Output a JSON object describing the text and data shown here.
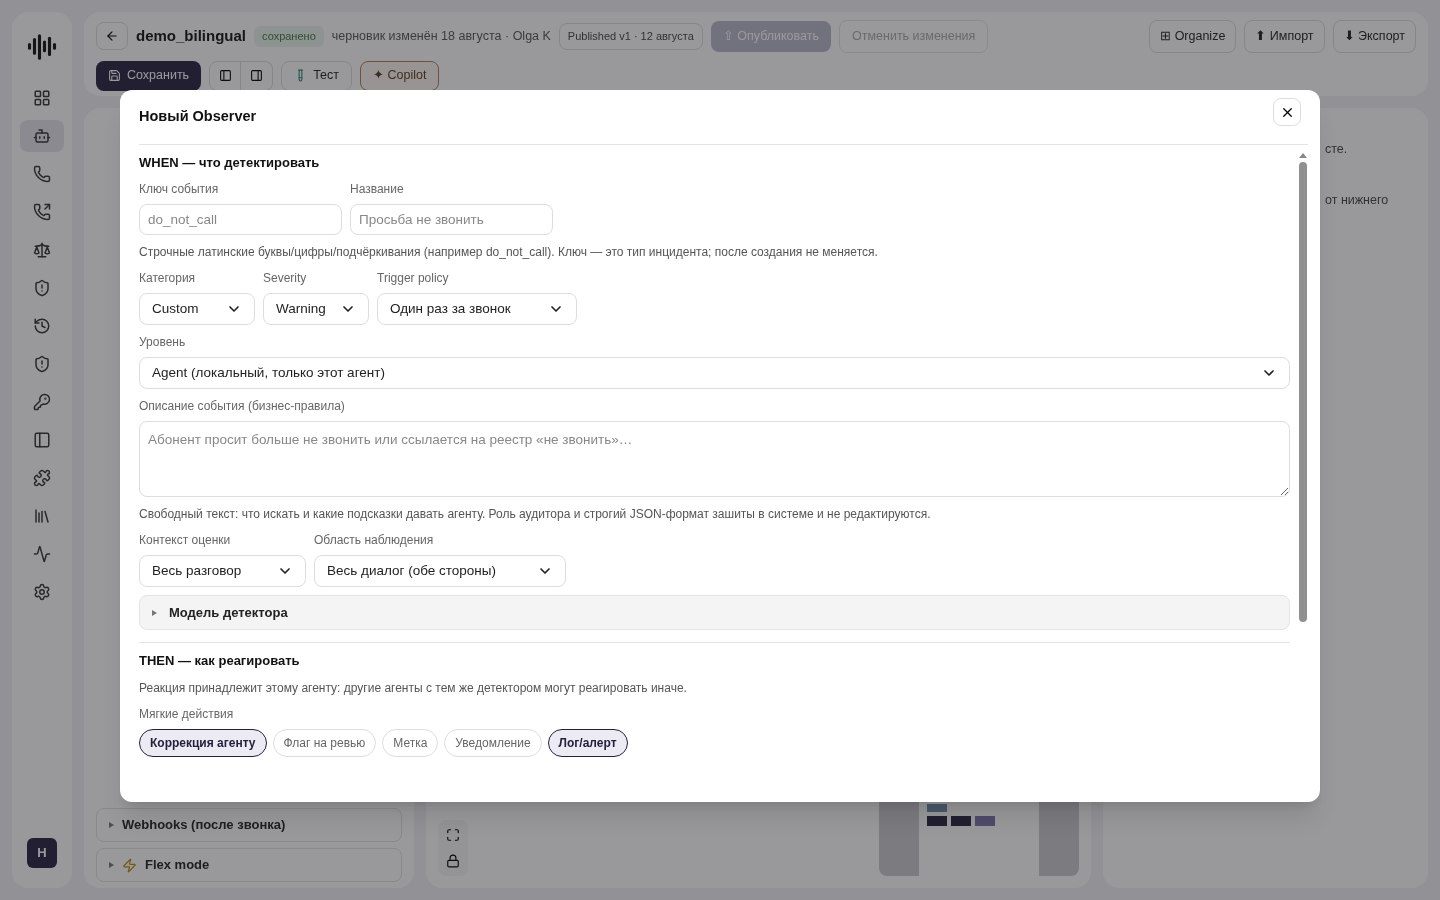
{
  "sidebar": {
    "avatar": "H",
    "items": [
      {
        "selected": false
      },
      {
        "selected": true
      },
      {
        "selected": false
      },
      {
        "selected": false
      },
      {
        "selected": false
      },
      {
        "selected": false
      },
      {
        "selected": false
      },
      {
        "selected": false
      },
      {
        "selected": false
      },
      {
        "selected": false
      },
      {
        "selected": false
      },
      {
        "selected": false
      },
      {
        "selected": false
      },
      {
        "selected": false
      }
    ]
  },
  "header": {
    "title": "demo_bilingual",
    "status": "сохранено",
    "draft_note": "черновик изменён 18 августа · Olga K",
    "published": "Published v1 · 12 августа",
    "publish_button": {
      "label": "⇧ Опубликовать",
      "disabled": true
    },
    "revert_button": {
      "label": "Отменить изменения",
      "disabled": true
    },
    "right_buttons": [
      "⊞ Organize",
      "⬆ Импорт",
      "⬇ Экспорт"
    ],
    "save_button": "Сохранить",
    "test_button": "Тест",
    "copilot_button": "✦ Copilot"
  },
  "left_panel": {
    "rows": [
      {
        "label": "Webhooks (после звонка)",
        "expanded": false
      },
      {
        "label": "Flex mode",
        "expanded": false
      }
    ]
  },
  "right_panel": {
    "fragments": [
      "сте.",
      "от нижнего"
    ]
  },
  "modal": {
    "title": "Новый Observer",
    "when": {
      "heading": "WHEN — что детектировать",
      "key_field": {
        "label": "Ключ события",
        "placeholder": "do_not_call"
      },
      "name_field": {
        "label": "Название",
        "placeholder": "Просьба не звонить"
      },
      "key_hint": "Строчные латинские буквы/цифры/подчёркивания (например do_not_call). Ключ — это тип инцидента; после создания не меняется.",
      "category": {
        "label": "Категория",
        "value": "Custom"
      },
      "severity": {
        "label": "Severity",
        "value": "Warning"
      },
      "trigger_policy": {
        "label": "Trigger policy",
        "value": "Один раз за звонок"
      },
      "level_select": {
        "label": "Уровень",
        "value": "Agent (локальный, только этот агент)"
      },
      "description": {
        "label": "Описание события (бизнес-правила)",
        "placeholder": "Абонент просит больше не звонить или ссылается на реестр «не звонить»…"
      },
      "description_hint": "Свободный текст: что искать и какие подсказки давать агенту. Роль аудитора и строгий JSON-формат зашиты в системе и не редактируются.",
      "context": {
        "label": "Контекст оценки",
        "value": "Весь разговор"
      },
      "scope": {
        "label": "Область наблюдения",
        "value": "Весь диалог (обе стороны)"
      },
      "detector_model": {
        "label": "Модель детектора",
        "expanded": false
      }
    },
    "then": {
      "heading": "THEN — как реагировать",
      "note": "Реакция принадлежит этому агенту: другие агенты с тем же детектором могут реагировать иначе.",
      "soft_actions_label": "Мягкие действия",
      "soft_actions": [
        {
          "label": "Коррекция агенту",
          "selected": true
        },
        {
          "label": "Флаг на ревью",
          "selected": false
        },
        {
          "label": "Метка",
          "selected": false
        },
        {
          "label": "Уведомление",
          "selected": false
        },
        {
          "label": "Лог/алерт",
          "selected": true
        }
      ]
    }
  }
}
